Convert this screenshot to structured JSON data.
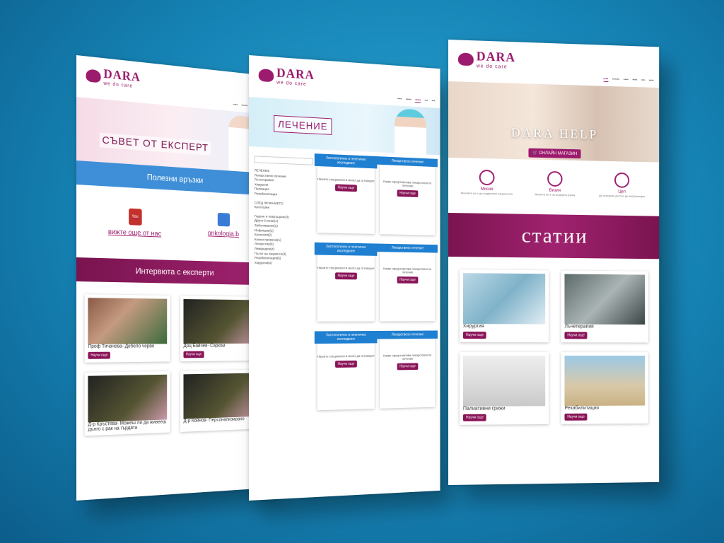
{
  "brand": {
    "name": "DARA",
    "tagline": "we do care"
  },
  "page1": {
    "hero_title": "СЪВЕТ ОТ ЕКСПЕРТ",
    "links_band": "Полезни връзки",
    "link_left": "вижте още от нас",
    "link_right": "onkologia.b",
    "interviews_band": "Интервюта с експерти",
    "cards": [
      {
        "title": "Проф Тичачева- Дебело черво",
        "btn": "Научи още"
      },
      {
        "title": "Доц Байчев- Сарком",
        "btn": "Научи още"
      },
      {
        "title": "Д-р Кръстева- Можеш ли да живееш дълго с рак на гърдата",
        "btn": ""
      },
      {
        "title": "Д-р Койнов- Персонализирано",
        "btn": ""
      }
    ]
  },
  "page2": {
    "hero_title": "ЛЕЧЕНИЕ",
    "sidebar": [
      "ЛЕЧЕНИЕ",
      "Лекарствено лечение",
      "Лъчетерапия",
      "Хирургия",
      "Палиация",
      "Рехабилитация",
      "СЛЕД ЛЕЧЕНИЕТО",
      "Категории",
      "Гадене и повръщане(3)",
      "Други Статии(1)",
      "Заболявания(1)",
      "Инфекции(1)",
      "Кахексия(2)",
      "Кожни промени(1)",
      "Лекарства(6)",
      "Лимфедем(4)",
      "Пътят на пациента(3)",
      "Рехабилитация(5)",
      "Хирургия(4)"
    ],
    "tiles": [
      {
        "ribbon": "Хистологично и генетично изследване",
        "body": "Нашите специалисти могат да отговорят"
      },
      {
        "ribbon": "Лекарствено лечение",
        "body": "Какво представлява лекарственото лечение"
      },
      {
        "ribbon": "Хистологично и генетично изследване",
        "body": "Нашите специалисти могат да отговорят"
      },
      {
        "ribbon": "Лекарствено лечение",
        "body": "Какво представлява лекарственото лечение"
      },
      {
        "ribbon": "Хистологично и генетично изследване",
        "body": "Нашите специалисти могат да отговорят"
      },
      {
        "ribbon": "Лекарствено лечение",
        "body": "Какво представлява лекарственото лечение"
      }
    ],
    "tile_btn": "Научи още"
  },
  "page3": {
    "hero_title": "DARA HELP",
    "shop_btn": "ОНЛАЙН МАГАЗИН",
    "vmv": [
      {
        "title": "Мисия",
        "text": "Мисията ни е да подкрепим пациентите"
      },
      {
        "title": "Визия",
        "text": "Визията ни е за модерна грижа"
      },
      {
        "title": "Цел",
        "text": "Да осигурим достъп до информация"
      }
    ],
    "articles_band": "статии",
    "articles": [
      {
        "title": "Хирургия",
        "btn": "Научи още"
      },
      {
        "title": "Лъчетерапия",
        "btn": "Научи още"
      },
      {
        "title": "Палиативни грижи",
        "btn": "Научи още"
      },
      {
        "title": "Рехабилитация",
        "btn": "Научи още"
      }
    ]
  }
}
